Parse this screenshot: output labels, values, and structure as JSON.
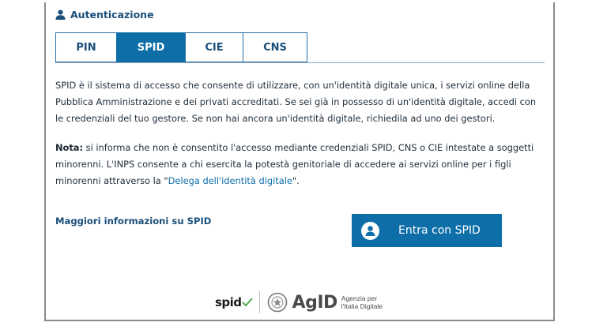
{
  "section_title": "Autenticazione",
  "tabs": [
    {
      "label": "PIN",
      "active": false
    },
    {
      "label": "SPID",
      "active": true
    },
    {
      "label": "CIE",
      "active": false
    },
    {
      "label": "CNS",
      "active": false
    }
  ],
  "intro": {
    "line1": "SPID è il sistema di accesso che consente di utilizzare, con un'identità digitale unica, i servizi online della",
    "line2": "Pubblica Amministrazione e dei privati accreditati. Se sei già in possesso di un'identità digitale, accedi con",
    "line3": "le credenziali del tuo gestore. Se non hai ancora un'identità digitale, richiedila ad uno dei gestori."
  },
  "note": {
    "label": "Nota:",
    "line1": " si informa che non è consentito l'accesso mediante credenziali SPID, CNS o CIE intestate a soggetti",
    "line2": "minorenni. L'INPS consente a chi esercita la potestà genitoriale di accedere ai servizi online per i figli",
    "line3_before": "minorenni attraverso la \"",
    "line3_link": "Delega dell'identità digitale",
    "line3_after": "\"."
  },
  "more_info_link": "Maggiori informazioni su SPID",
  "login_button": "Entra con SPID",
  "footer": {
    "spid_logo_text": "spid",
    "agid_logo_text": "AgID",
    "agid_sub_line1": "Agenzia per",
    "agid_sub_line2": "l'Italia Digitale"
  },
  "colors": {
    "primary": "#0d6ea8",
    "heading": "#1a4f7a",
    "spid_check": "#4caf50"
  }
}
